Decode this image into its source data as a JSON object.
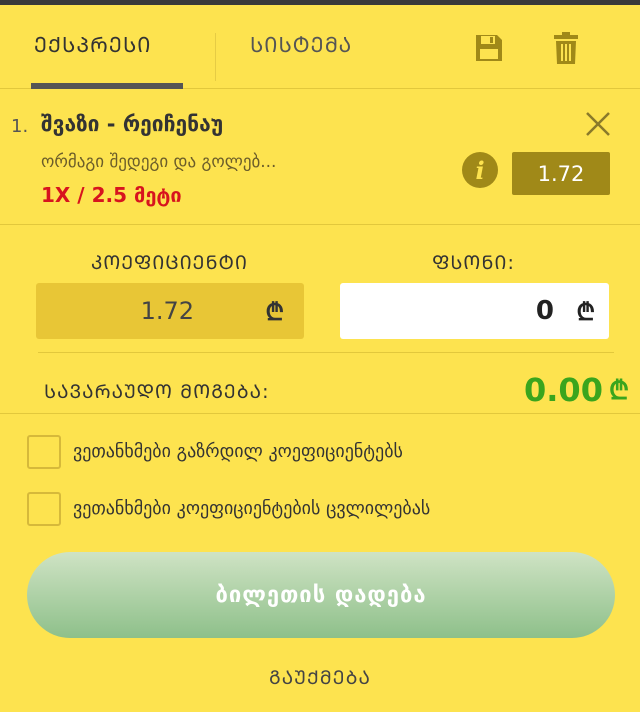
{
  "tabs": {
    "express": "ᲔᲥᲡᲞᲠᲔᲡᲘ",
    "system": "ᲡᲘᲡᲢᲔᲛᲐ"
  },
  "icons": {
    "save": "floppy-disk",
    "trash": "trash-can",
    "close": "x-mark",
    "info": "info-circle"
  },
  "bet": {
    "index": "1.",
    "teams": "შვაზი - რეიჩენაუ",
    "market": "ორმაგი შედეგი და გოლებ...",
    "pick": "1X / 2.5 მეტი",
    "odd": "1.72"
  },
  "coefficient": {
    "label": "ᲙᲝᲔᲤᲘᲪᲘᲔᲜᲢᲘ",
    "value": "1.72",
    "currency": "₾"
  },
  "stake": {
    "label": "ᲤᲡᲝᲜᲘ:",
    "value": "0",
    "currency": "₾"
  },
  "possible_win": {
    "label": "ᲡᲐᲕᲐᲠᲐᲣᲓᲝ ᲛᲝᲒᲔᲑᲐ:",
    "value": "0.00",
    "currency": "₾"
  },
  "checkboxes": [
    {
      "label": "ვეთანხმები გაზრდილ კოეფიციენტებს"
    },
    {
      "label": "ვეთანხმები კოეფიციენტების ცვლილებას"
    }
  ],
  "place_button": "ბილეთის დადება",
  "cancel": "ᲒᲐᲣᲥᲛᲔᲑᲐ",
  "colors": {
    "background": "#fde34f",
    "accent": "#a08918",
    "win": "#3aa51d",
    "pick": "#d7141e"
  }
}
